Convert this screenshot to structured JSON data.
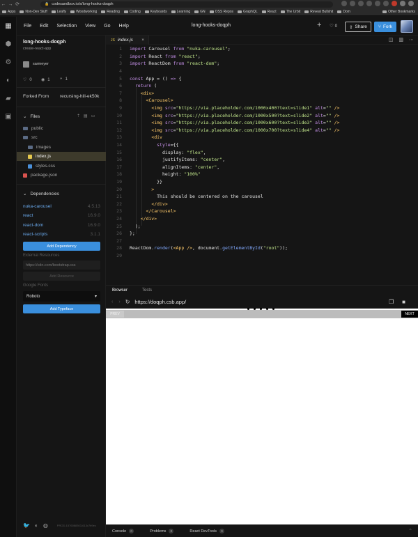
{
  "browser": {
    "url": "codesandbox.io/s/long-hooks-doqph",
    "bookmarks": [
      "Apps",
      "Non-Dev Stuff",
      "Leafly",
      "Woodworking",
      "Reading",
      "Coding",
      "Keyboards",
      "Learning",
      "GN",
      "OSS Repos",
      "GraphQL",
      "React",
      "The Urbit",
      "Reveal Bullshit",
      "Dom"
    ],
    "other_bookmarks": "Other Bookmarks"
  },
  "menubar": {
    "items": [
      "File",
      "Edit",
      "Selection",
      "View",
      "Go",
      "Help"
    ],
    "title": "long-hooks-doqph",
    "likes": "0",
    "share_label": "Share",
    "fork_label": "Fork"
  },
  "sidebar": {
    "project_name": "long-hooks-doqph",
    "template": "create-react-app",
    "user": "sarmeyer",
    "stats": {
      "likes": "0",
      "views": "1",
      "forks": "1"
    },
    "forked_from_label": "Forked From",
    "forked_from_value": "recursing-hill-ek50k",
    "files_label": "Files",
    "tree": [
      {
        "name": "public",
        "type": "folder"
      },
      {
        "name": "src",
        "type": "folder"
      },
      {
        "name": "images",
        "type": "folder"
      },
      {
        "name": "index.js",
        "type": "js"
      },
      {
        "name": "styles.css",
        "type": "css"
      },
      {
        "name": "package.json",
        "type": "json"
      }
    ],
    "dependencies_label": "Dependencies",
    "dependencies": [
      {
        "name": "nuka-carousel",
        "version": "4.5.13"
      },
      {
        "name": "react",
        "version": "16.9.0"
      },
      {
        "name": "react-dom",
        "version": "16.9.0"
      },
      {
        "name": "react-scripts",
        "version": "3.1.1"
      }
    ],
    "add_dependency": "Add Dependency",
    "external_resources_label": "External Resources",
    "external_placeholder": "https://cdn.com/bootstrap.css",
    "add_resource": "Add Resource",
    "google_fonts_label": "Google Fonts",
    "font_selected": "Roboto",
    "add_typeface": "Add Typeface",
    "version": "PROD-1576088303-613c7b9ec"
  },
  "editor": {
    "tab_name": "index.js",
    "tab_icon": "JS",
    "line_numbers": [
      "1",
      "2",
      "3",
      "4",
      "5",
      "6",
      "7",
      "8",
      "9",
      "10",
      "11",
      "12",
      "13",
      "14",
      "15",
      "16",
      "17",
      "18",
      "19",
      "20",
      "21",
      "22",
      "23",
      "24",
      "25",
      "26",
      "27",
      "28",
      "29"
    ]
  },
  "preview": {
    "tabs": [
      "Browser",
      "Tests"
    ],
    "url": "https://doqph.csb.app/",
    "prev_label": "PREV",
    "next_label": "NEXT",
    "dot_count": 5
  },
  "bottom": {
    "items": [
      {
        "label": "Console",
        "count": "0"
      },
      {
        "label": "Problems",
        "count": "0"
      },
      {
        "label": "React DevTools",
        "count": "0"
      }
    ]
  },
  "colors": {
    "accent": "#3a8fdd",
    "keyword": "#c792ea",
    "string": "#c3e88d",
    "tag": "#ffcb6b",
    "function": "#82aaff"
  }
}
